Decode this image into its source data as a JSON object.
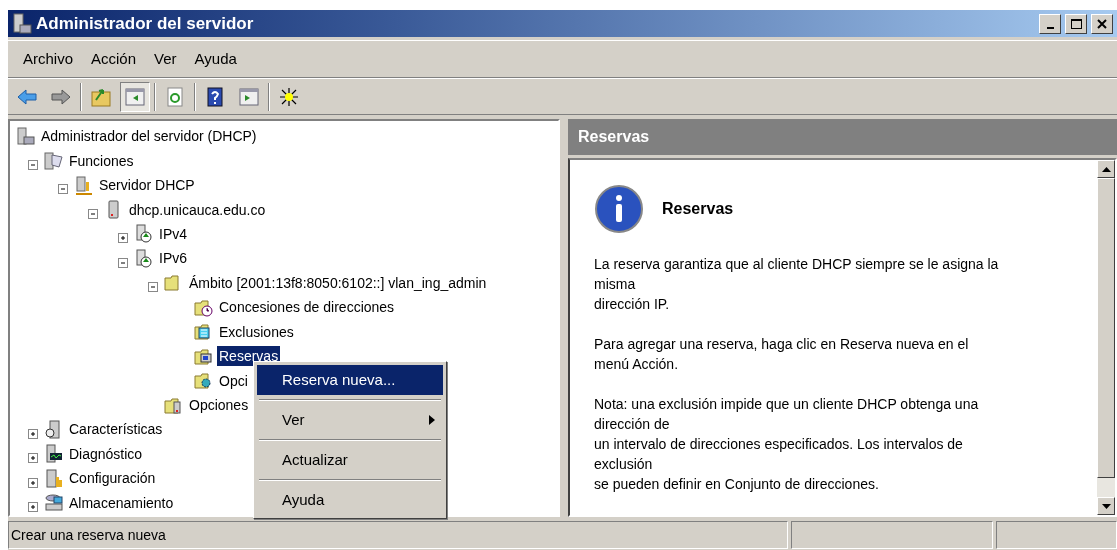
{
  "window": {
    "title": "Administrador del servidor"
  },
  "menu": [
    "Archivo",
    "Acción",
    "Ver",
    "Ayuda"
  ],
  "toolbar": [
    {
      "kind": "back",
      "pressed": false
    },
    {
      "kind": "forward",
      "pressed": false
    },
    {
      "kind": "sep"
    },
    {
      "kind": "up",
      "pressed": false
    },
    {
      "kind": "tree",
      "pressed": true
    },
    {
      "kind": "sep"
    },
    {
      "kind": "refresh",
      "pressed": false
    },
    {
      "kind": "sep"
    },
    {
      "kind": "help",
      "pressed": false
    },
    {
      "kind": "panel",
      "pressed": false
    },
    {
      "kind": "sep"
    },
    {
      "kind": "star",
      "pressed": false
    }
  ],
  "tree": [
    {
      "label": "Administrador del servidor (DHCP)",
      "kind": "manager",
      "selected": false,
      "children": [
        {
          "label": "Funciones",
          "kind": "roles",
          "expanded": true,
          "selected": false,
          "children": [
            {
              "label": "Servidor DHCP",
              "kind": "dhcp",
              "expanded": true,
              "selected": false,
              "children": [
                {
                  "label": "dhcp.unicauca.edu.co",
                  "kind": "server",
                  "expanded": true,
                  "selected": false,
                  "children": [
                    {
                      "label": "IPv4",
                      "kind": "ip",
                      "expanded": false,
                      "selected": false
                    },
                    {
                      "label": "IPv6",
                      "kind": "ip",
                      "expanded": true,
                      "selected": false,
                      "children": [
                        {
                          "label": "Ámbito [2001:13f8:8050:6102::] vlan_ing_admin",
                          "kind": "folder",
                          "expanded": true,
                          "selected": false,
                          "children": [
                            {
                              "label": "Concesiones de direcciones",
                              "kind": "clock-folder",
                              "selected": false
                            },
                            {
                              "label": "Exclusiones",
                              "kind": "list-folder",
                              "selected": false
                            },
                            {
                              "label": "Reservas",
                              "kind": "card-folder",
                              "selected": true
                            },
                            {
                              "label": "Opci",
                              "kind": "gear-folder",
                              "selected": false
                            }
                          ]
                        },
                        {
                          "label": "Opciones",
                          "kind": "server-folder",
                          "selected": false
                        }
                      ]
                    }
                  ]
                }
              ]
            }
          ]
        },
        {
          "label": "Características",
          "kind": "features",
          "expanded": false,
          "selected": false
        },
        {
          "label": "Diagnóstico",
          "kind": "diagnostics",
          "expanded": false,
          "selected": false
        },
        {
          "label": "Configuración",
          "kind": "config",
          "expanded": false,
          "selected": false
        },
        {
          "label": "Almacenamiento",
          "kind": "storage",
          "expanded": false,
          "selected": false
        }
      ]
    }
  ],
  "context_menu": [
    {
      "kind": "item",
      "label": "Reserva nueva...",
      "selected": true
    },
    {
      "kind": "sep"
    },
    {
      "kind": "submenu",
      "label": "Ver",
      "selected": false
    },
    {
      "kind": "sep"
    },
    {
      "kind": "item",
      "label": "Actualizar",
      "selected": false
    },
    {
      "kind": "sep"
    },
    {
      "kind": "item",
      "label": "Ayuda",
      "selected": false
    }
  ],
  "details": {
    "header": "Reservas",
    "title": "Reservas",
    "paragraphs": [
      [
        "La reserva garantiza que al cliente DHCP siempre se le asigna la",
        "misma",
        "dirección IP."
      ],
      [
        "Para agregar una reserva, haga clic en Reserva nueva en el",
        "menú Acción."
      ],
      [
        "Nota: una exclusión impide que un cliente DHCP obtenga una",
        "dirección de",
        "un intervalo de direcciones especificados. Los intervalos de",
        "exclusión",
        "se pueden definir en Conjunto de direcciones."
      ]
    ]
  },
  "status_bar": [
    "Crear una reserva nueva"
  ]
}
